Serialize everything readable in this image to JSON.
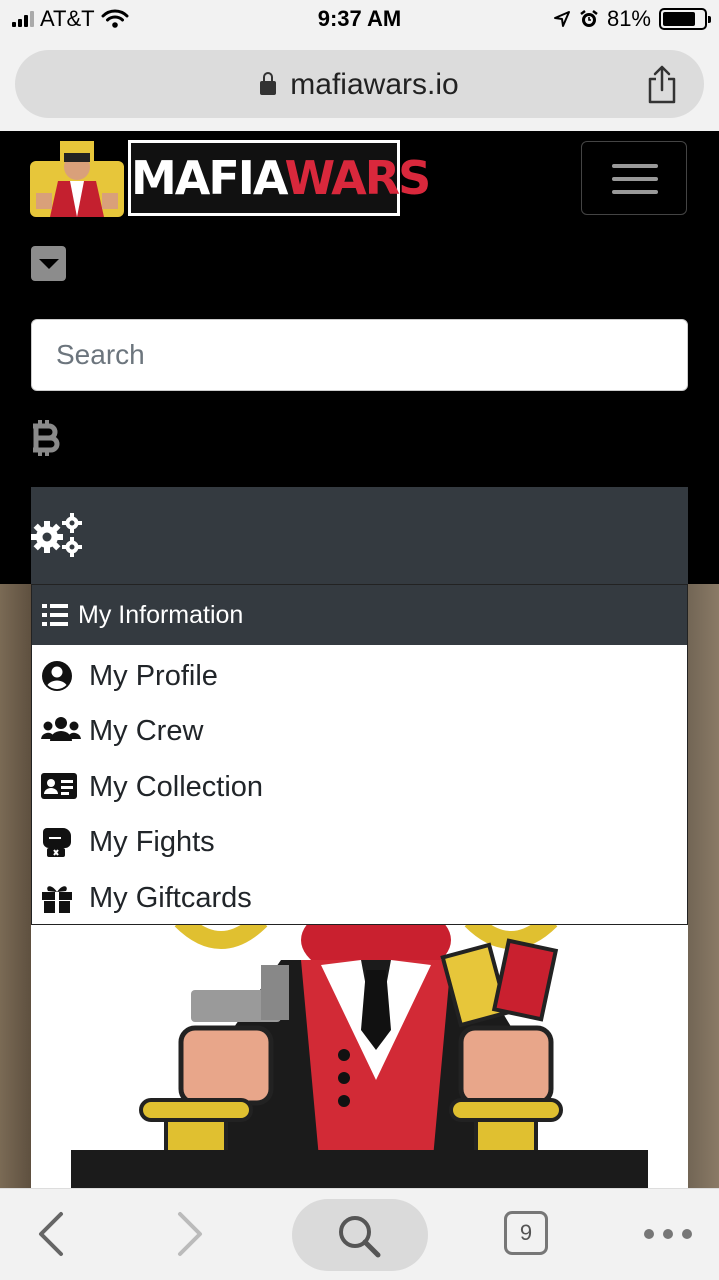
{
  "status_bar": {
    "carrier": "AT&T",
    "time": "9:37 AM",
    "battery_percent": "81%",
    "battery_level": 0.81
  },
  "browser": {
    "domain": "mafiawars.io",
    "tab_count": "9"
  },
  "site": {
    "logo_word_1": "MAFIA",
    "logo_word_2": "WARS",
    "search_placeholder": "Search",
    "bitcoin_icon": "bitcoin-icon",
    "settings_icon": "gears-icon"
  },
  "dropdown": {
    "header": "My Information",
    "items": [
      {
        "label": "My Profile",
        "icon": "user-circle-icon"
      },
      {
        "label": "My Crew",
        "icon": "users-icon"
      },
      {
        "label": "My Collection",
        "icon": "id-card-icon"
      },
      {
        "label": "My Fights",
        "icon": "boxing-glove-icon"
      },
      {
        "label": "My Giftcards",
        "icon": "gift-icon"
      }
    ]
  },
  "colors": {
    "header_bg": "#000000",
    "panel_bg": "#343a40",
    "accent_red": "#d9283c",
    "browser_chrome": "#f2f2f2"
  }
}
